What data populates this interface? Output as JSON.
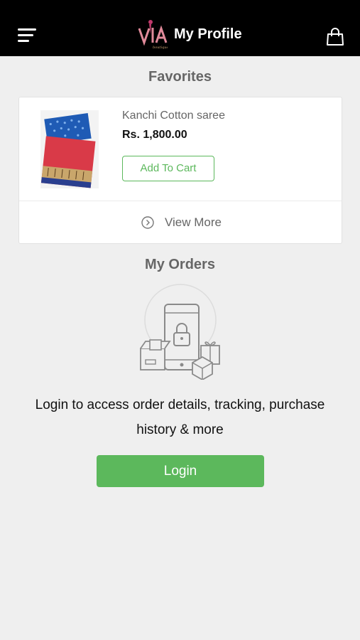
{
  "header": {
    "title": "My Profile",
    "logo_icon": "vila-boutique-logo",
    "menu_icon": "hamburger-menu-icon",
    "cart_icon": "shopping-bag-icon",
    "background": "#000000"
  },
  "favorites": {
    "title": "Favorites",
    "items": [
      {
        "name": "Kanchi Cotton saree",
        "price": "Rs. 1,800.00",
        "add_to_cart_label": "Add To Cart"
      }
    ],
    "view_more_label": "View More",
    "view_more_icon": "chevron-circle-right-icon"
  },
  "orders": {
    "title": "My Orders",
    "illustration_icon": "locked-phone-packages-icon",
    "message": "Login to access order details, tracking, purchase history & more",
    "login_label": "Login"
  },
  "colors": {
    "accent": "#5cb85c",
    "background": "#efefef"
  }
}
